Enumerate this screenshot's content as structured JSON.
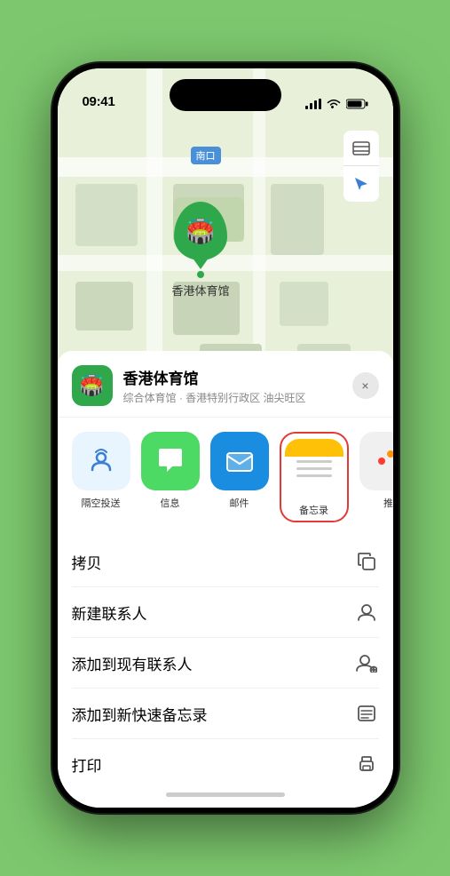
{
  "status_bar": {
    "time": "09:41",
    "signal_icon": "signal-icon",
    "wifi_icon": "wifi-icon",
    "battery_icon": "battery-icon"
  },
  "map": {
    "location_label": "南口",
    "pin_label": "香港体育馆",
    "map_btn_layers": "⊞",
    "map_btn_location": "➤"
  },
  "venue": {
    "name": "香港体育馆",
    "subtitle": "综合体育馆 · 香港特别行政区 油尖旺区",
    "close_label": "×"
  },
  "share_items": [
    {
      "id": "airdrop",
      "label": "隔空投送",
      "type": "airdrop"
    },
    {
      "id": "messages",
      "label": "信息",
      "type": "messages"
    },
    {
      "id": "mail",
      "label": "邮件",
      "type": "mail"
    },
    {
      "id": "notes",
      "label": "备忘录",
      "type": "notes"
    },
    {
      "id": "more",
      "label": "推",
      "type": "more"
    }
  ],
  "actions": [
    {
      "id": "copy",
      "label": "拷贝",
      "icon": "copy-icon"
    },
    {
      "id": "new-contact",
      "label": "新建联系人",
      "icon": "new-contact-icon"
    },
    {
      "id": "add-existing",
      "label": "添加到现有联系人",
      "icon": "add-contact-icon"
    },
    {
      "id": "add-notes",
      "label": "添加到新快速备忘录",
      "icon": "quick-note-icon"
    },
    {
      "id": "print",
      "label": "打印",
      "icon": "print-icon"
    }
  ],
  "colors": {
    "green_accent": "#2ea84b",
    "map_bg": "#e8f0d8",
    "sheet_bg": "#ffffff",
    "notes_yellow": "#ffc107",
    "highlight_red": "#e53935"
  }
}
